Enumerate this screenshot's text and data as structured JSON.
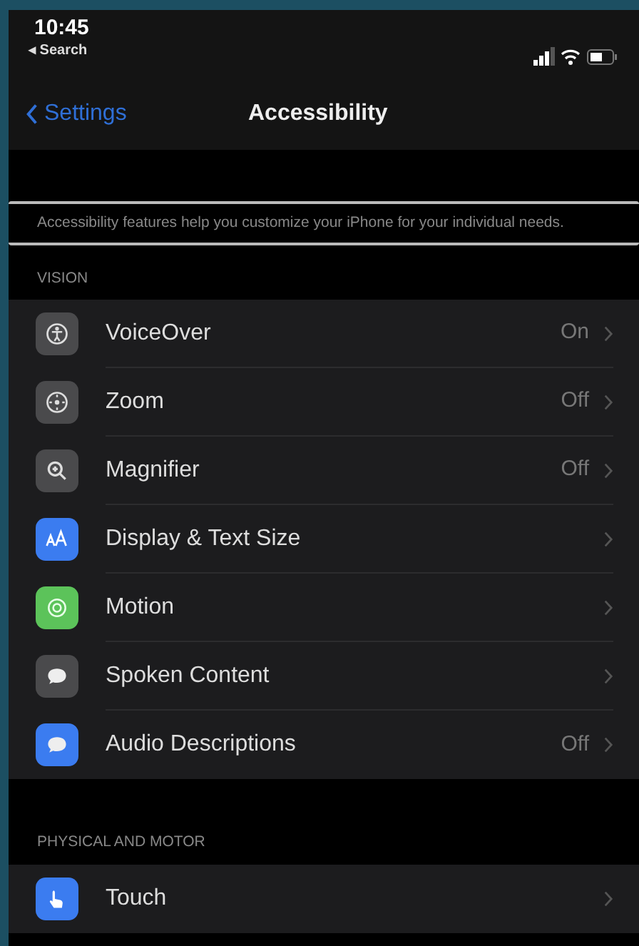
{
  "status_bar": {
    "time": "10:45",
    "back_link": "◂ Search"
  },
  "nav": {
    "back": "Settings",
    "title": "Accessibility"
  },
  "description": "Accessibility features help you customize your iPhone for your individual needs.",
  "sections": [
    {
      "header": "VISION",
      "items": [
        {
          "label": "VoiceOver",
          "value": "On",
          "color": "#4a4a4c"
        },
        {
          "label": "Zoom",
          "value": "Off",
          "color": "#4a4a4c"
        },
        {
          "label": "Magnifier",
          "value": "Off",
          "color": "#4a4a4c"
        },
        {
          "label": "Display & Text Size",
          "color": "#3b7cf0"
        },
        {
          "label": "Motion",
          "color": "#5cc35a"
        },
        {
          "label": "Spoken Content",
          "color": "#4a4a4c"
        },
        {
          "label": "Audio Descriptions",
          "value": "Off",
          "color": "#3b7cf0"
        }
      ]
    },
    {
      "header": "PHYSICAL AND MOTOR",
      "items": [
        {
          "label": "Touch",
          "color": "#3b7cf0"
        }
      ]
    }
  ]
}
